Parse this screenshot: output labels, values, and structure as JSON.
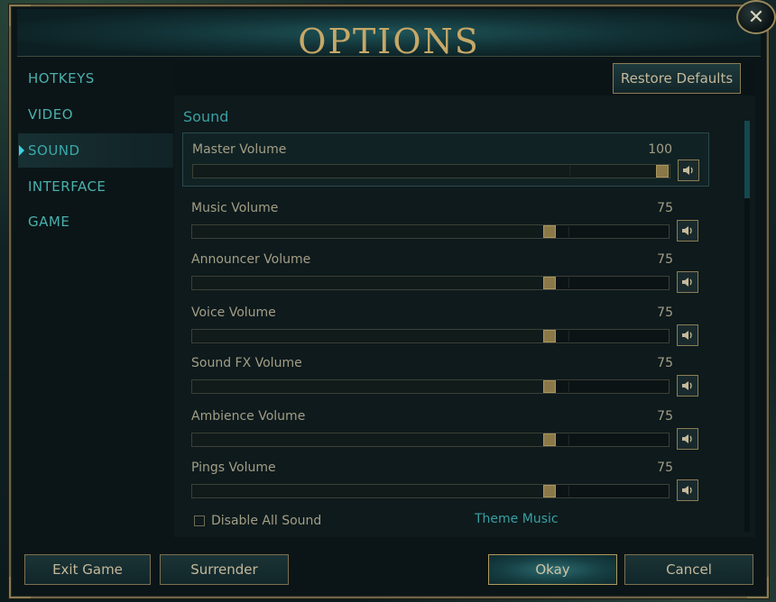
{
  "window": {
    "title": "OPTIONS",
    "close_symbol": "✕"
  },
  "sidebar": {
    "items": [
      {
        "label": "HOTKEYS"
      },
      {
        "label": "VIDEO"
      },
      {
        "label": "SOUND"
      },
      {
        "label": "INTERFACE"
      },
      {
        "label": "GAME"
      }
    ],
    "active": "SOUND"
  },
  "content": {
    "restore_defaults_label": "Restore Defaults",
    "section_title": "Sound",
    "volumes": [
      {
        "label": "Master Volume",
        "value": "100",
        "level": 100
      },
      {
        "label": "Music Volume",
        "value": "75",
        "level": 75
      },
      {
        "label": "Announcer Volume",
        "value": "75",
        "level": 75
      },
      {
        "label": "Voice Volume",
        "value": "75",
        "level": 75
      },
      {
        "label": "Sound FX Volume",
        "value": "75",
        "level": 75
      },
      {
        "label": "Ambience Volume",
        "value": "75",
        "level": 75
      },
      {
        "label": "Pings Volume",
        "value": "75",
        "level": 75
      }
    ],
    "disable_all_sound_label": "Disable All Sound",
    "theme_music_label": "Theme Music"
  },
  "footer": {
    "exit_game_label": "Exit Game",
    "surrender_label": "Surrender",
    "okay_label": "Okay",
    "cancel_label": "Cancel"
  },
  "colors": {
    "accent_gold": "#c6a868",
    "accent_teal": "#3c9fa2",
    "text_muted": "#a39e86"
  }
}
